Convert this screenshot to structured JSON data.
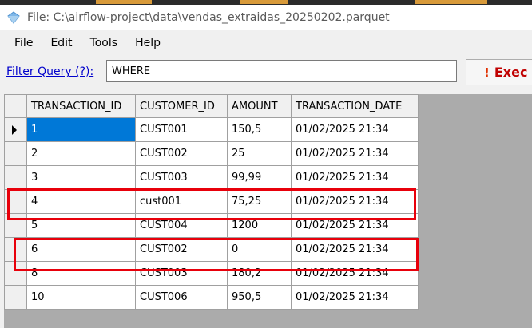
{
  "window": {
    "title": "File: C:\\airflow-project\\data\\vendas_extraidas_20250202.parquet"
  },
  "menu": [
    "File",
    "Edit",
    "Tools",
    "Help"
  ],
  "filter": {
    "label": "Filter Query (?):",
    "value": "WHERE",
    "execute_label": "Exec"
  },
  "table": {
    "columns": [
      "TRANSACTION_ID",
      "CUSTOMER_ID",
      "AMOUNT",
      "TRANSACTION_DATE"
    ],
    "rows": [
      [
        "1",
        "CUST001",
        "150,5",
        "01/02/2025 21:34"
      ],
      [
        "2",
        "CUST002",
        "25",
        "01/02/2025 21:34"
      ],
      [
        "3",
        "CUST003",
        "99,99",
        "01/02/2025 21:34"
      ],
      [
        "4",
        "cust001",
        "75,25",
        "01/02/2025 21:34"
      ],
      [
        "5",
        "CUST004",
        "1200",
        "01/02/2025 21:34"
      ],
      [
        "6",
        "CUST002",
        "0",
        "01/02/2025 21:34"
      ],
      [
        "8",
        "CUST003",
        "180,2",
        "01/02/2025 21:34"
      ],
      [
        "10",
        "CUST006",
        "950,5",
        "01/02/2025 21:34"
      ]
    ],
    "selected_row": 0,
    "highlighted_rows": [
      3,
      5
    ]
  },
  "colors": {
    "highlight": "#e8000b",
    "selection": "#0078d7"
  }
}
